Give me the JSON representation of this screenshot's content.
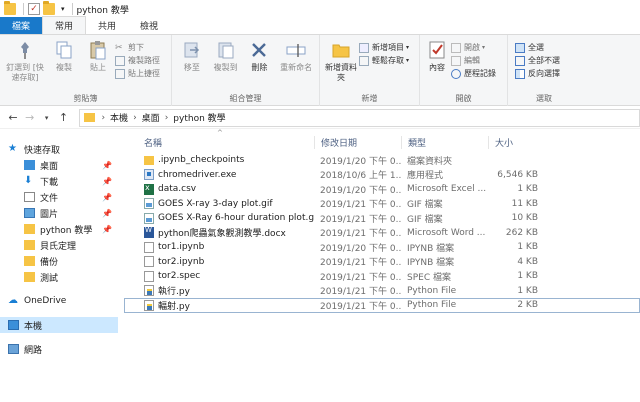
{
  "window": {
    "title": "python 教學"
  },
  "tabs": [
    {
      "label": "檔案"
    },
    {
      "label": "常用"
    },
    {
      "label": "共用"
    },
    {
      "label": "檢視"
    }
  ],
  "ribbon": {
    "clipboard": {
      "label": "剪貼簿",
      "pin": "釘選到 [快速存取]",
      "copy": "複製",
      "paste": "貼上",
      "cut": "剪下",
      "copy_path": "複製路徑",
      "paste_shortcut": "貼上捷徑"
    },
    "organize": {
      "label": "組合管理",
      "move_to": "移至",
      "copy_to": "複製到",
      "delete": "刪除",
      "rename": "重新命名"
    },
    "new": {
      "label": "新增",
      "new_folder": "新增資料夾",
      "new_item": "新增項目",
      "easy_access": "輕鬆存取"
    },
    "open": {
      "label": "開啟",
      "properties": "內容",
      "open": "開啟",
      "edit": "編輯",
      "history": "歷程記錄"
    },
    "select": {
      "label": "選取",
      "select_all": "全選",
      "select_none": "全部不選",
      "invert": "反向選擇"
    }
  },
  "address": {
    "crumbs": [
      "本機",
      "桌面",
      "python 教學"
    ]
  },
  "nav": {
    "quick_access": "快速存取",
    "items": [
      {
        "label": "桌面",
        "pinned": true
      },
      {
        "label": "下載",
        "pinned": true
      },
      {
        "label": "文件",
        "pinned": true
      },
      {
        "label": "圖片",
        "pinned": true
      },
      {
        "label": "python 教學",
        "pinned": true
      },
      {
        "label": "貝氏定理",
        "pinned": false
      },
      {
        "label": "備份",
        "pinned": false
      },
      {
        "label": "測試",
        "pinned": false
      }
    ],
    "onedrive": "OneDrive",
    "this_pc": "本機",
    "network": "網路"
  },
  "columns": {
    "name": "名稱",
    "date": "修改日期",
    "type": "類型",
    "size": "大小"
  },
  "files": [
    {
      "name": ".ipynb_checkpoints",
      "date": "2019/1/20 下午 0...",
      "type": "檔案資料夾",
      "size": "",
      "icon": "folder"
    },
    {
      "name": "chromedriver.exe",
      "date": "2018/10/6 上午 1...",
      "type": "應用程式",
      "size": "6,546 KB",
      "icon": "exe"
    },
    {
      "name": "data.csv",
      "date": "2019/1/20 下午 0...",
      "type": "Microsoft Excel ...",
      "size": "1 KB",
      "icon": "excel"
    },
    {
      "name": "GOES X-ray 3-day plot.gif",
      "date": "2019/1/21 下午 0...",
      "type": "GIF 檔案",
      "size": "11 KB",
      "icon": "image"
    },
    {
      "name": "GOES X-Ray 6-hour duration plot.gif",
      "date": "2019/1/21 下午 0...",
      "type": "GIF 檔案",
      "size": "10 KB",
      "icon": "image"
    },
    {
      "name": "python爬蟲氣象觀測教學.docx",
      "date": "2019/1/21 下午 0...",
      "type": "Microsoft Word ...",
      "size": "262 KB",
      "icon": "word"
    },
    {
      "name": "tor1.ipynb",
      "date": "2019/1/20 下午 0...",
      "type": "IPYNB 檔案",
      "size": "1 KB",
      "icon": "doc"
    },
    {
      "name": "tor2.ipynb",
      "date": "2019/1/21 下午 0...",
      "type": "IPYNB 檔案",
      "size": "4 KB",
      "icon": "doc"
    },
    {
      "name": "tor2.spec",
      "date": "2019/1/21 下午 0...",
      "type": "SPEC 檔案",
      "size": "1 KB",
      "icon": "doc"
    },
    {
      "name": "執行.py",
      "date": "2019/1/21 下午 0...",
      "type": "Python File",
      "size": "1 KB",
      "icon": "python"
    },
    {
      "name": "輻射.py",
      "date": "2019/1/21 下午 0...",
      "type": "Python File",
      "size": "2 KB",
      "icon": "python"
    }
  ]
}
